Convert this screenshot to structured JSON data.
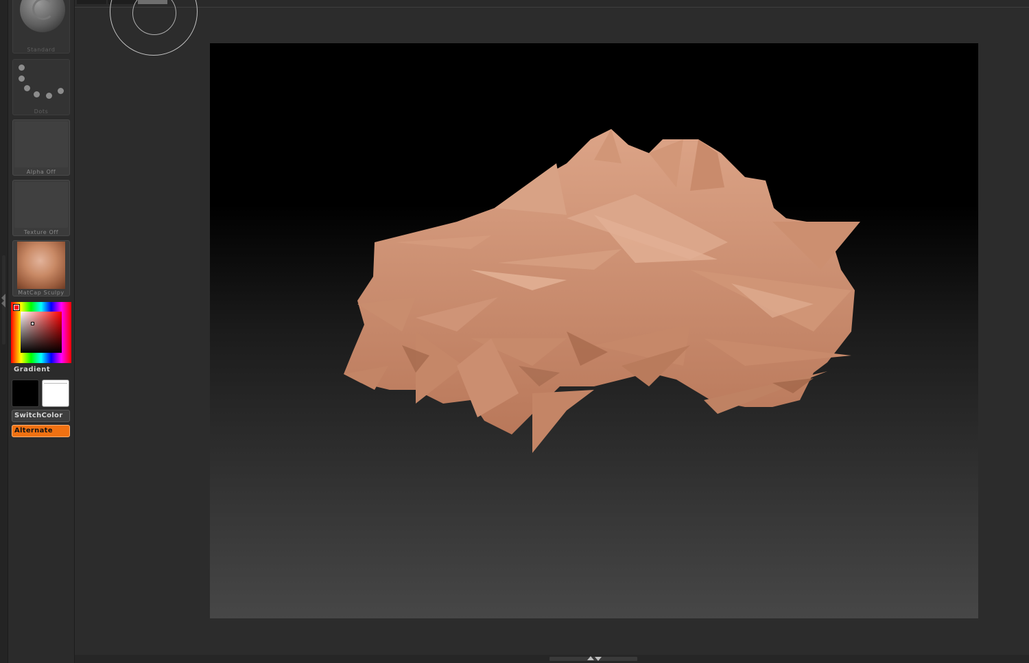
{
  "tray": {
    "brush_label": "Standard",
    "stroke_label": "Dots",
    "alpha_label": "Alpha  Off",
    "texture_label": "Texture  Off",
    "material_label": "MatCap  Sculpy"
  },
  "color": {
    "gradient_label": "Gradient",
    "main_color": "#000000",
    "secondary_color": "#ffffff",
    "switch_label": "SwitchColor",
    "alternate_label": "Alternate",
    "accent": "#f07112"
  },
  "icons": {
    "gutter": "chevron-left-icon",
    "gyro": "gyro-icon",
    "bottom_handle": "expand-collapse-icon"
  },
  "canvas": {
    "model_color": "#cf9270"
  }
}
